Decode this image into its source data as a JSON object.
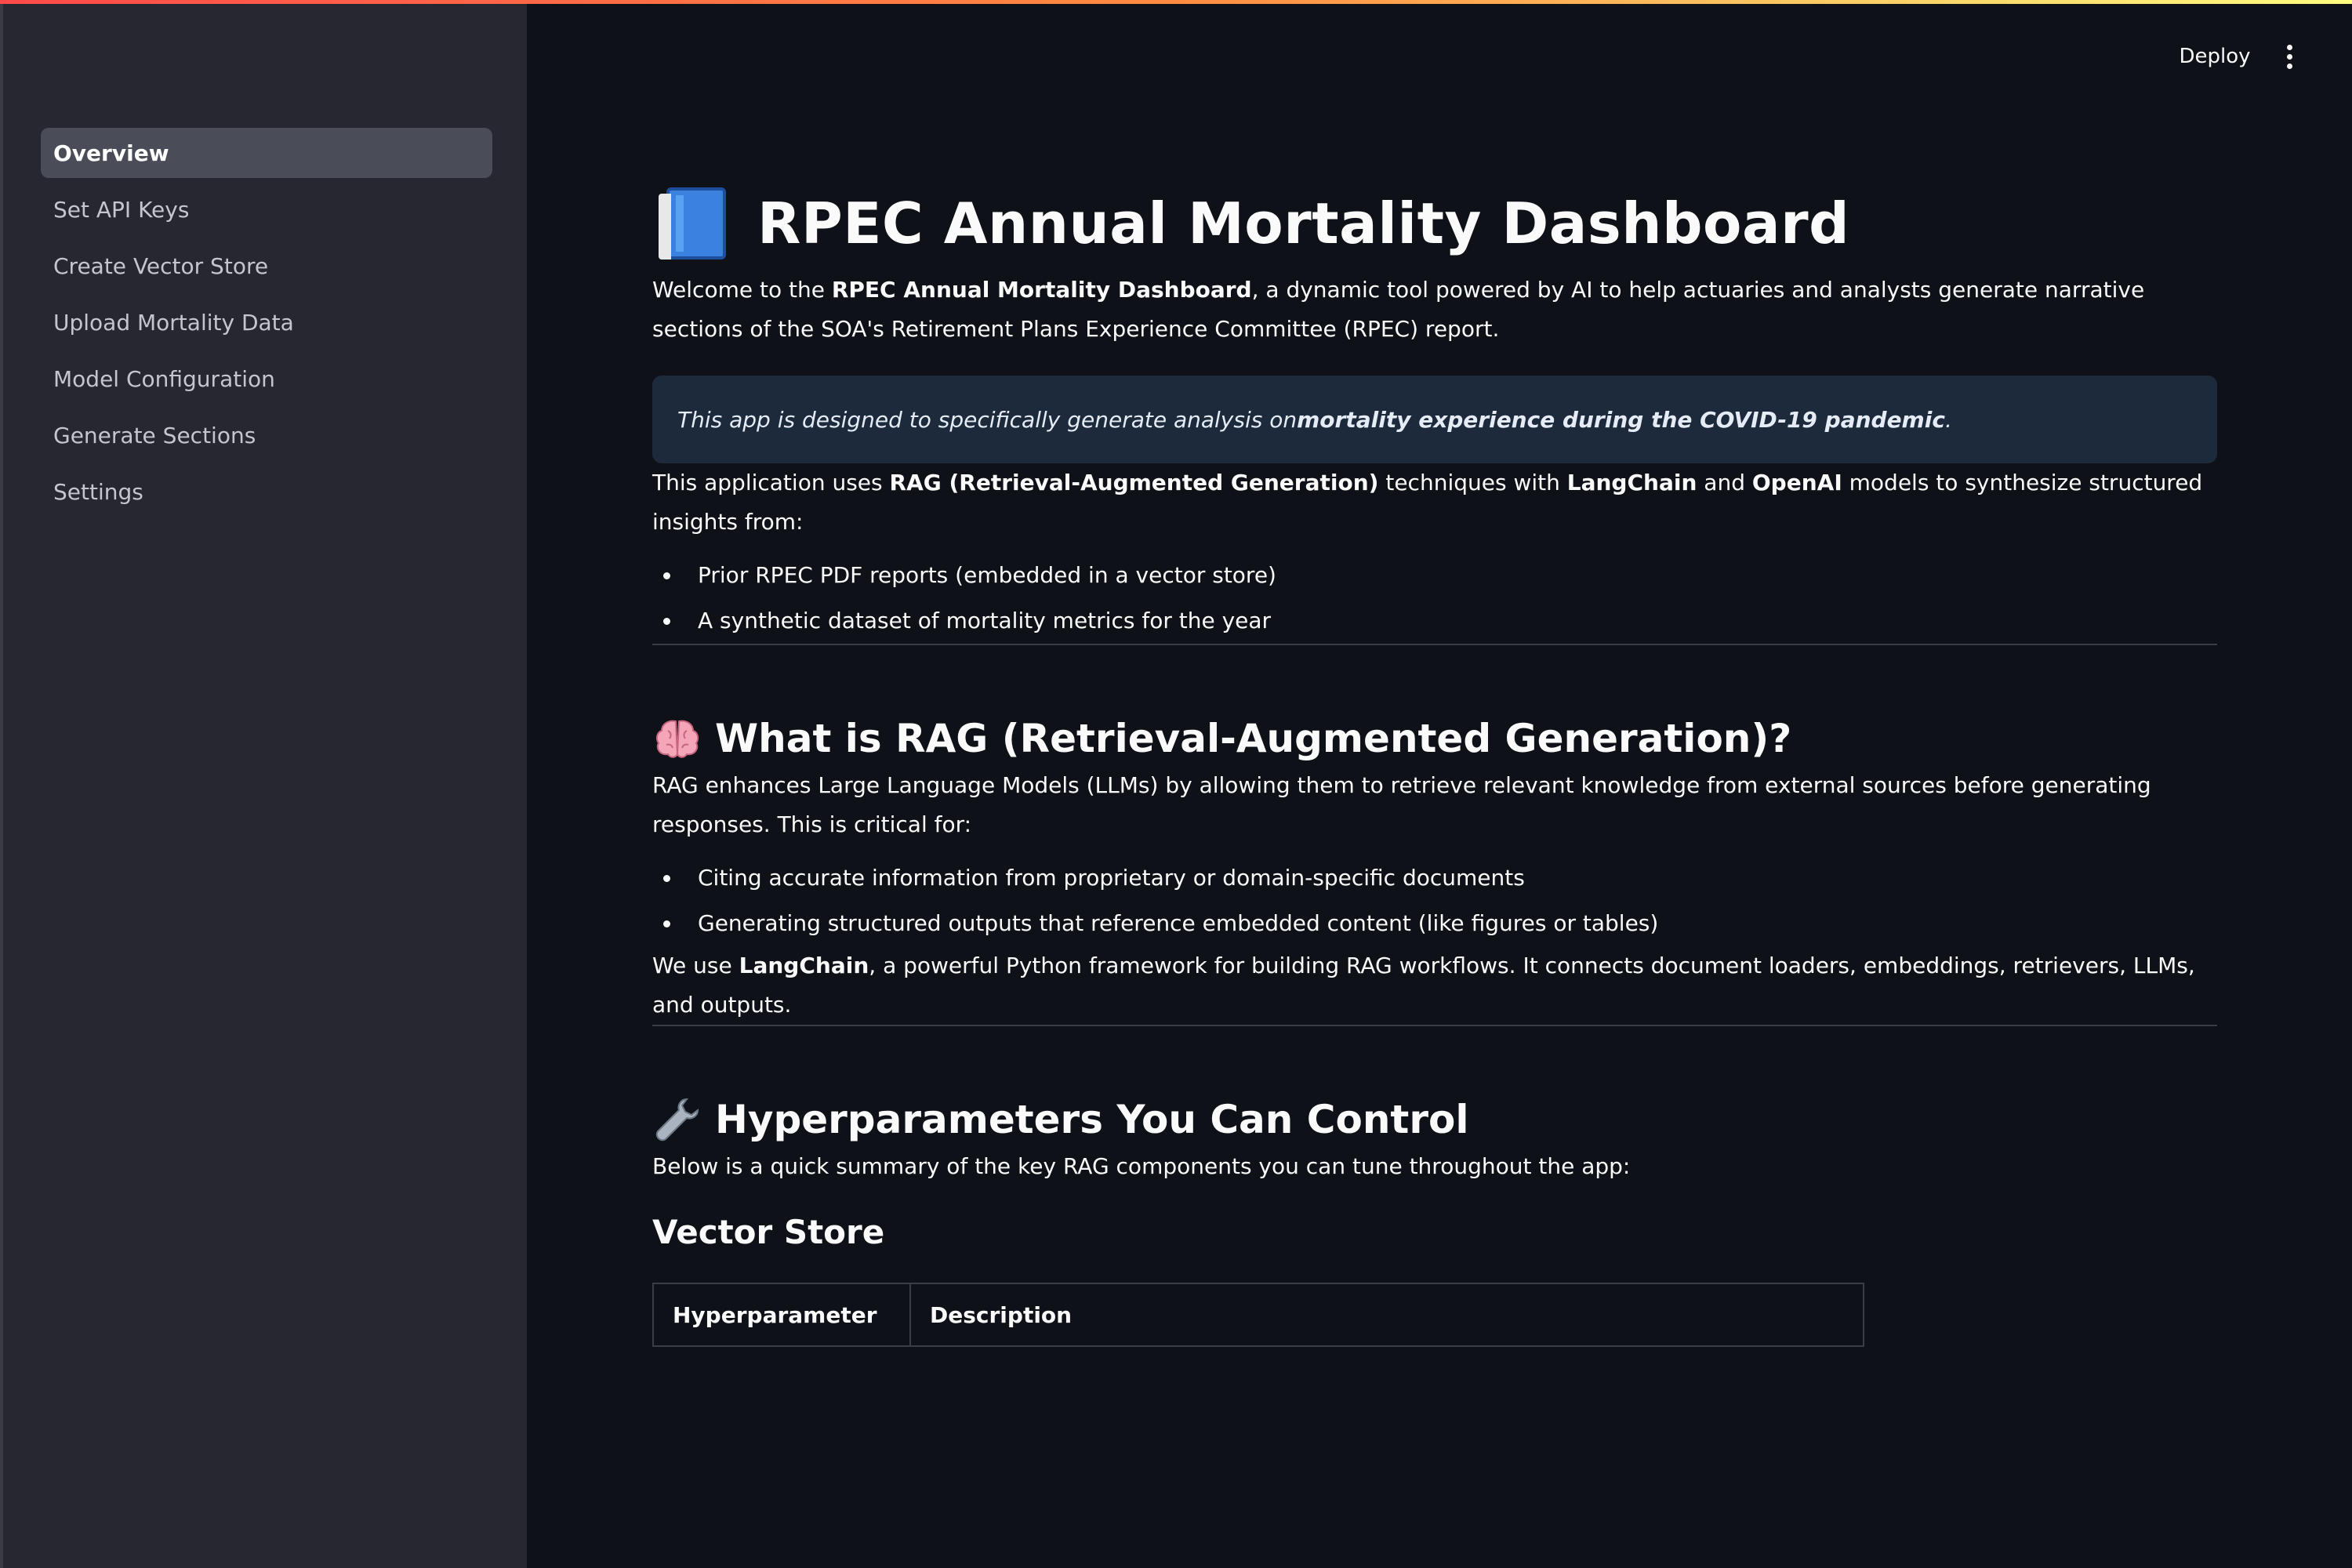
{
  "header": {
    "deploy_label": "Deploy"
  },
  "sidebar": {
    "items": [
      {
        "label": "Overview",
        "active": true
      },
      {
        "label": "Set API Keys",
        "active": false
      },
      {
        "label": "Create Vector Store",
        "active": false
      },
      {
        "label": "Upload Mortality Data",
        "active": false
      },
      {
        "label": "Model Configuration",
        "active": false
      },
      {
        "label": "Generate Sections",
        "active": false
      },
      {
        "label": "Settings",
        "active": false
      }
    ]
  },
  "main": {
    "title_icon": "book-icon",
    "title": "RPEC Annual Mortality Dashboard",
    "intro": {
      "pre": "Welcome to the ",
      "bold": "RPEC Annual Mortality Dashboard",
      "post": ", a dynamic tool powered by AI to help actuaries and analysts generate narrative sections of the SOA's Retirement Plans Experience Committee (RPEC) report."
    },
    "info": {
      "pre": "This app is designed to specifically generate analysis on ",
      "bold": "mortality experience during the COVID-19 pandemic",
      "post": "."
    },
    "uses": {
      "t1": "This application uses ",
      "b1": "RAG (Retrieval-Augmented Generation)",
      "t2": " techniques with ",
      "b2": "LangChain",
      "t3": " and ",
      "b3": "OpenAI",
      "t4": " models to synthesize structured insights from:"
    },
    "sources": [
      "Prior RPEC PDF reports (embedded in a vector store)",
      "A synthetic dataset of mortality metrics for the year"
    ],
    "rag_section": {
      "icon": "brain-icon",
      "heading": "What is RAG (Retrieval-Augmented Generation)?",
      "text": "RAG enhances Large Language Models (LLMs) by allowing them to retrieve relevant knowledge from external sources before generating responses. This is critical for:",
      "bullets": [
        "Citing accurate information from proprietary or domain-specific documents",
        "Generating structured outputs that reference embedded content (like figures or tables)"
      ],
      "we_use": {
        "pre": "We use ",
        "bold": "LangChain",
        "post": ", a powerful Python framework for building RAG workflows. It connects document loaders, embeddings, retrievers, LLMs, and outputs."
      }
    },
    "hyper_section": {
      "icon": "wrench-icon",
      "heading": "Hyperparameters You Can Control",
      "text": "Below is a quick summary of the key RAG components you can tune throughout the app:",
      "subheading": "Vector Store",
      "table_headers": [
        "Hyperparameter",
        "Description"
      ]
    }
  }
}
